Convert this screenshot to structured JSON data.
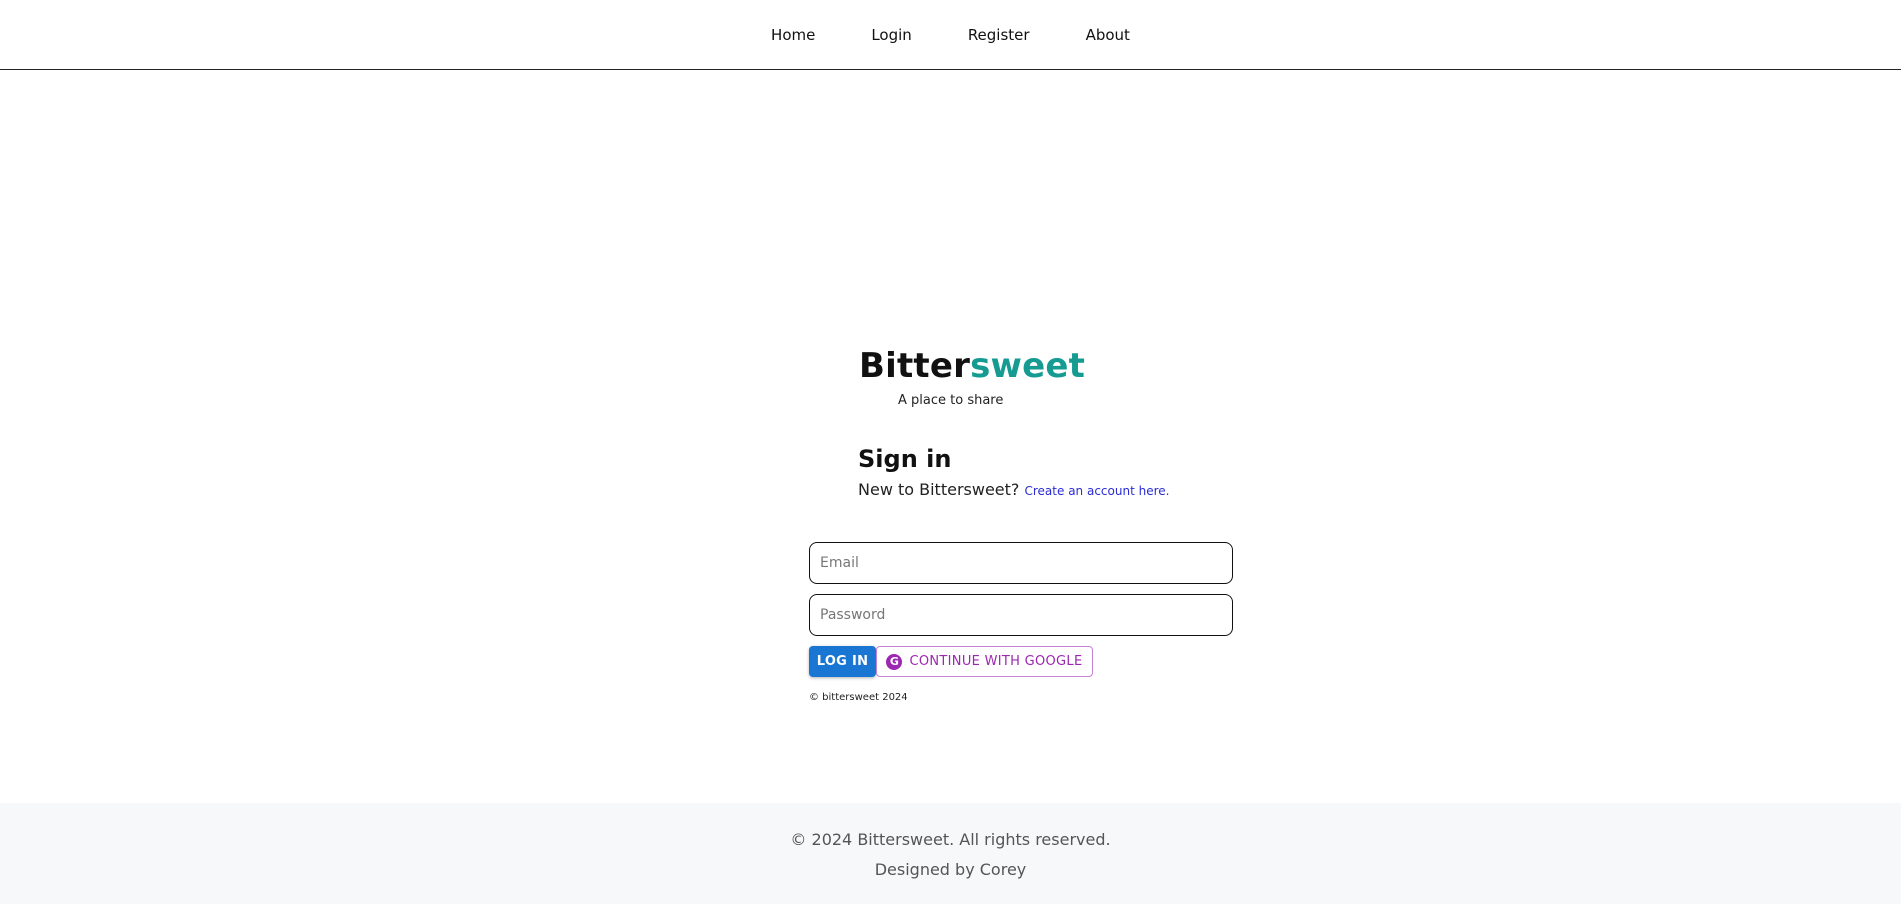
{
  "nav": {
    "items": [
      {
        "label": "Home"
      },
      {
        "label": "Login"
      },
      {
        "label": "Register"
      },
      {
        "label": "About"
      }
    ]
  },
  "brand": {
    "part1": "Bitter",
    "part2": "sweet",
    "accent_color": "#169b92",
    "tagline": "A place to share"
  },
  "signin": {
    "title": "Sign in",
    "prompt": "New to Bittersweet?",
    "create_link": "Create an account here."
  },
  "form": {
    "email_placeholder": "Email",
    "password_placeholder": "Password",
    "login_label": "LOG IN",
    "google_label": "CONTINUE WITH GOOGLE",
    "google_icon": "google-icon",
    "login_color": "#1976d2",
    "google_color": "#9c27b0"
  },
  "small_copyright": "© bittersweet 2024",
  "footer": {
    "line1": "© 2024 Bittersweet. All rights reserved.",
    "line2": "Designed by Corey"
  }
}
